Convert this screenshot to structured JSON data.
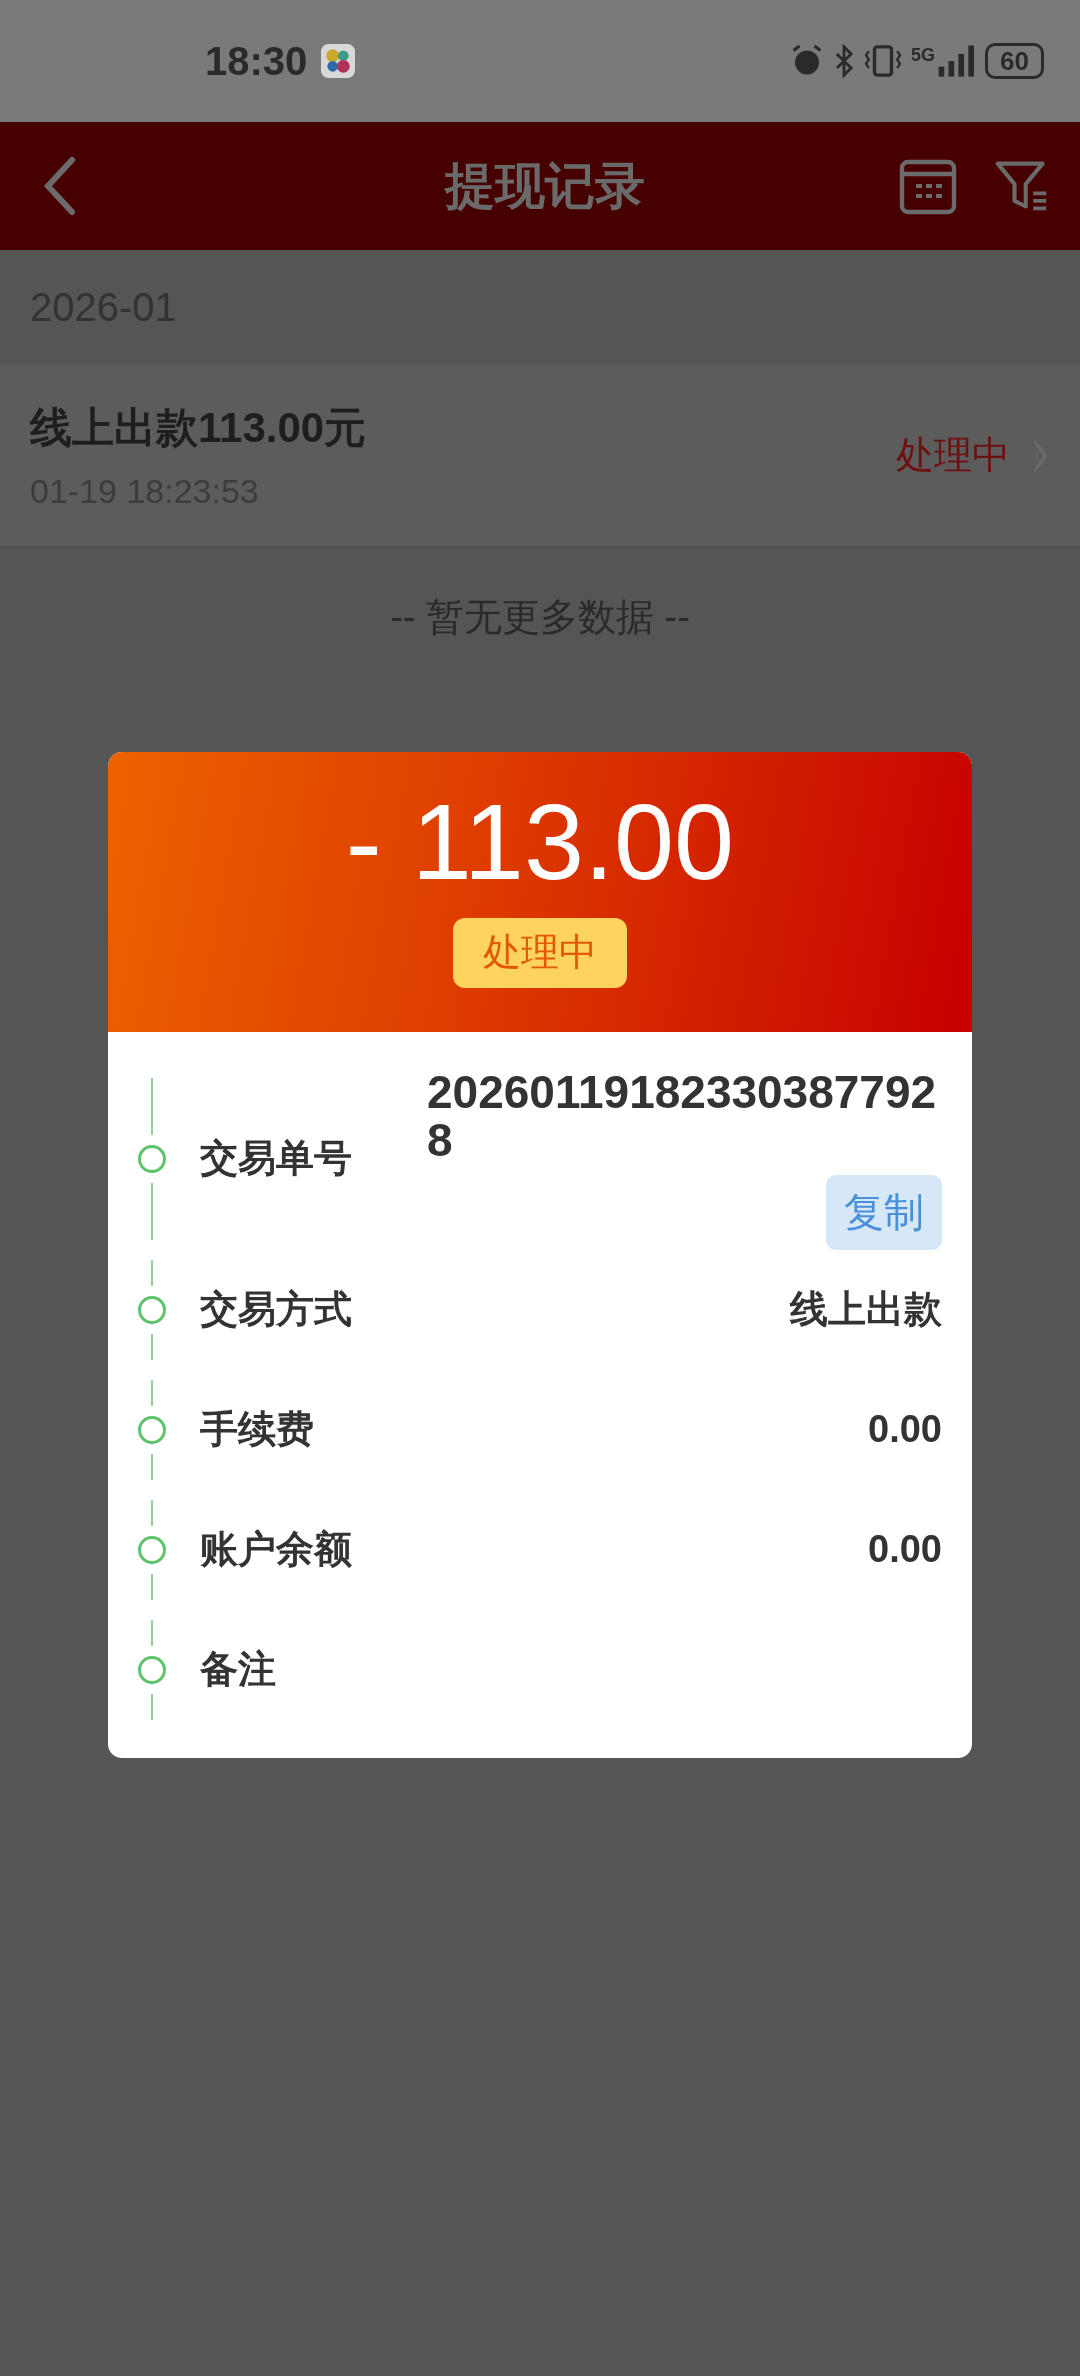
{
  "status_bar": {
    "time": "18:30",
    "network": "5G",
    "battery": "60"
  },
  "header": {
    "title": "提现记录"
  },
  "month": "2026-01",
  "records": [
    {
      "title": "线上出款113.00元",
      "time": "01-19 18:23:53",
      "status": "处理中"
    }
  ],
  "end_note": "-- 暂无更多数据 --",
  "detail": {
    "amount": "- 113.00",
    "status": "处理中",
    "fields": [
      {
        "kind": "copyable",
        "label": "交易单号",
        "value": "202601191823303877928",
        "action": "复制"
      },
      {
        "kind": "plain",
        "label": "交易方式",
        "value": "线上出款"
      },
      {
        "kind": "plain",
        "label": "手续费",
        "value": "0.00"
      },
      {
        "kind": "plain",
        "label": "账户余额",
        "value": "0.00"
      },
      {
        "kind": "plain",
        "label": "备注"
      }
    ]
  }
}
